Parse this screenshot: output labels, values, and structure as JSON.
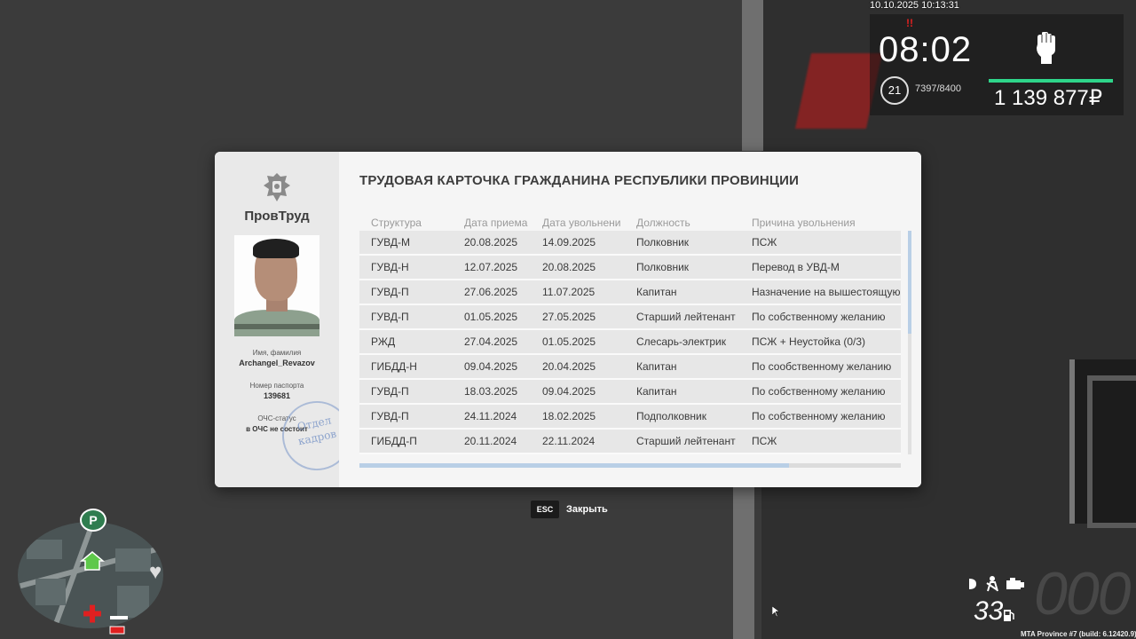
{
  "hud": {
    "datetime": "10.10.2025 10:13:31",
    "alert_mark": "!!",
    "time": "08:02",
    "level": "21",
    "exp": "7397/8400",
    "money": "1 139 877₽",
    "fist_icon": "fist-icon",
    "colors": {
      "money_bar": "#2ed58a",
      "alert": "#e02020"
    }
  },
  "card": {
    "org_name": "ПровТруд",
    "emblem_icon": "eagle-emblem-icon",
    "name_label": "Имя, фамилия",
    "name_value": "Archangel_Revazov",
    "passport_label": "Номер паспорта",
    "passport_value": "139681",
    "ochs_label": "ОЧС-статус",
    "ochs_value": "в ОЧС не состоит",
    "stamp_line1": "Отдел",
    "stamp_line2": "кадров",
    "title": "ТРУДОВАЯ КАРТОЧКА ГРАЖДАНИНА РЕСПУБЛИКИ ПРОВИНЦИИ",
    "columns": [
      "Структура",
      "Дата приема",
      "Дата увольнени",
      "Должность",
      "Причина увольнения"
    ],
    "rows": [
      [
        "ГУВД-М",
        "20.08.2025",
        "14.09.2025",
        "Полковник",
        "ПСЖ"
      ],
      [
        "ГУВД-Н",
        "12.07.2025",
        "20.08.2025",
        "Полковник",
        "Перевод в УВД-М"
      ],
      [
        "ГУВД-П",
        "27.06.2025",
        "11.07.2025",
        "Капитан",
        "Назначение на вышестоящую"
      ],
      [
        "ГУВД-П",
        "01.05.2025",
        "27.05.2025",
        "Старший лейтенант",
        "По собственному желанию"
      ],
      [
        "РЖД",
        "27.04.2025",
        "01.05.2025",
        "Слесарь-электрик",
        "ПСЖ + Неустойка (0/3)"
      ],
      [
        "ГИБДД-Н",
        "09.04.2025",
        "20.04.2025",
        "Капитан",
        "По сообственному желанию"
      ],
      [
        "ГУВД-П",
        "18.03.2025",
        "09.04.2025",
        "Капитан",
        "По собственному желанию"
      ],
      [
        "ГУВД-П",
        "24.11.2024",
        "18.02.2025",
        "Подполковник",
        "По собственному желанию"
      ],
      [
        "ГИБДД-П",
        "20.11.2024",
        "22.11.2024",
        "Старший лейтенант",
        "ПСЖ"
      ]
    ]
  },
  "close_hint": {
    "key": "ESC",
    "label": "Закрыть"
  },
  "minimap": {
    "parking_badge": "P",
    "icons": [
      "parking-icon",
      "house-icon",
      "hospital-cross-icon",
      "heart-icon",
      "car-icon"
    ]
  },
  "vehicle": {
    "speed": "33",
    "ghost_speed": "000",
    "icons": [
      "headlight-icon",
      "seatbelt-icon",
      "engine-icon",
      "fuel-icon"
    ]
  },
  "build_info": "MTA Province #7 (build: 6.12420.9)"
}
